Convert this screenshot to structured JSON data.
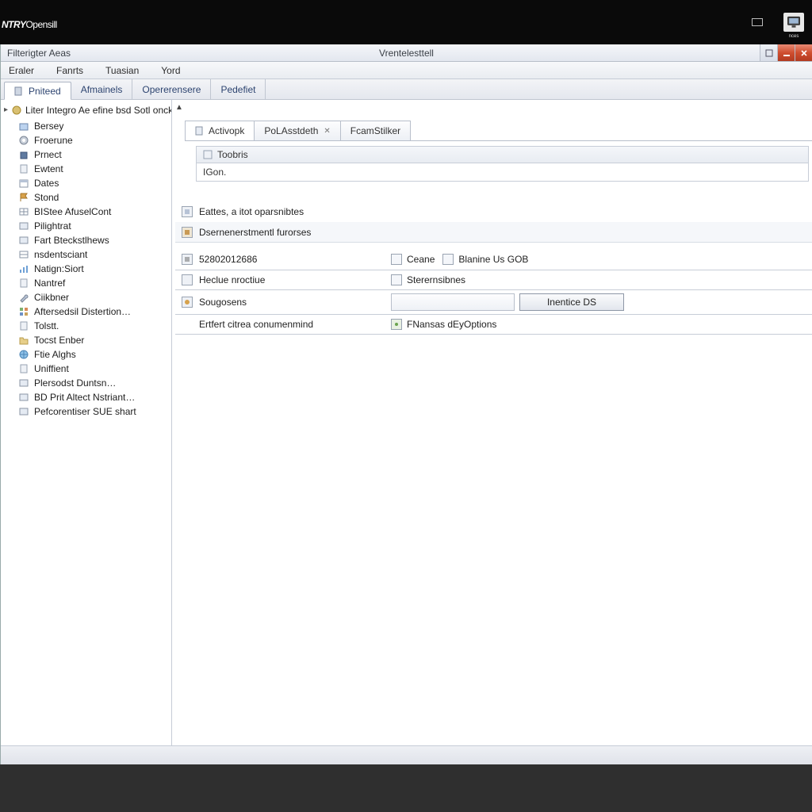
{
  "brand": {
    "bold": "NTRY",
    "thin": "Opensill"
  },
  "titlebar": {
    "left": "Filterigter Aeas",
    "center": "Vrentelesttell"
  },
  "menu": [
    "Eraler",
    "Fanrts",
    "Tuasian",
    "Yord"
  ],
  "maintabs": [
    "Pniteed",
    "Afmainels",
    "Opererensere",
    "Pedefiet"
  ],
  "tree": {
    "root": "Liter Integro Ae efine bsd Sotl onckreaci…",
    "items": [
      "Bersey",
      "Froerune",
      "Prnect",
      "Ewtent",
      "Dates",
      "Stond",
      "BIStee AfuselCont",
      "Pilightrat",
      "Fart Bteckstlhews",
      "nsdentsciant",
      "Natign:Siort",
      "Nantref",
      "Ciikbner",
      "Aftersedsil Distertion…",
      "Tolstt.",
      "Tocst Enber",
      "Ftie Alghs",
      "Uniffient",
      "Plersodst Duntsn…",
      "BD Prit Altect Nstriant…",
      "Pefcorentiser SUE shart"
    ]
  },
  "inner_tabs": [
    "Activopk",
    "PoLAsstdeth",
    "FcamStilker"
  ],
  "fieldsbox": {
    "header": "Toobris",
    "row": "IGon."
  },
  "sections": {
    "s1": "Eattes, a itot oparsnibtes",
    "s2": "Dsernenerstmentl furorses"
  },
  "rows": {
    "r1a": "52802012686",
    "r1b1": "Ceane",
    "r1b2": "Blanine Us GOB",
    "r2a": "Heclue nroctiue",
    "r2b": "Sterernsibnes",
    "r3a": "Sougosens",
    "r3btn": "Inentice DS",
    "r4a": "Ertfert citrea conumenmind",
    "r4b": "FNansas dEyOptions"
  },
  "topbar_caption": "nces"
}
